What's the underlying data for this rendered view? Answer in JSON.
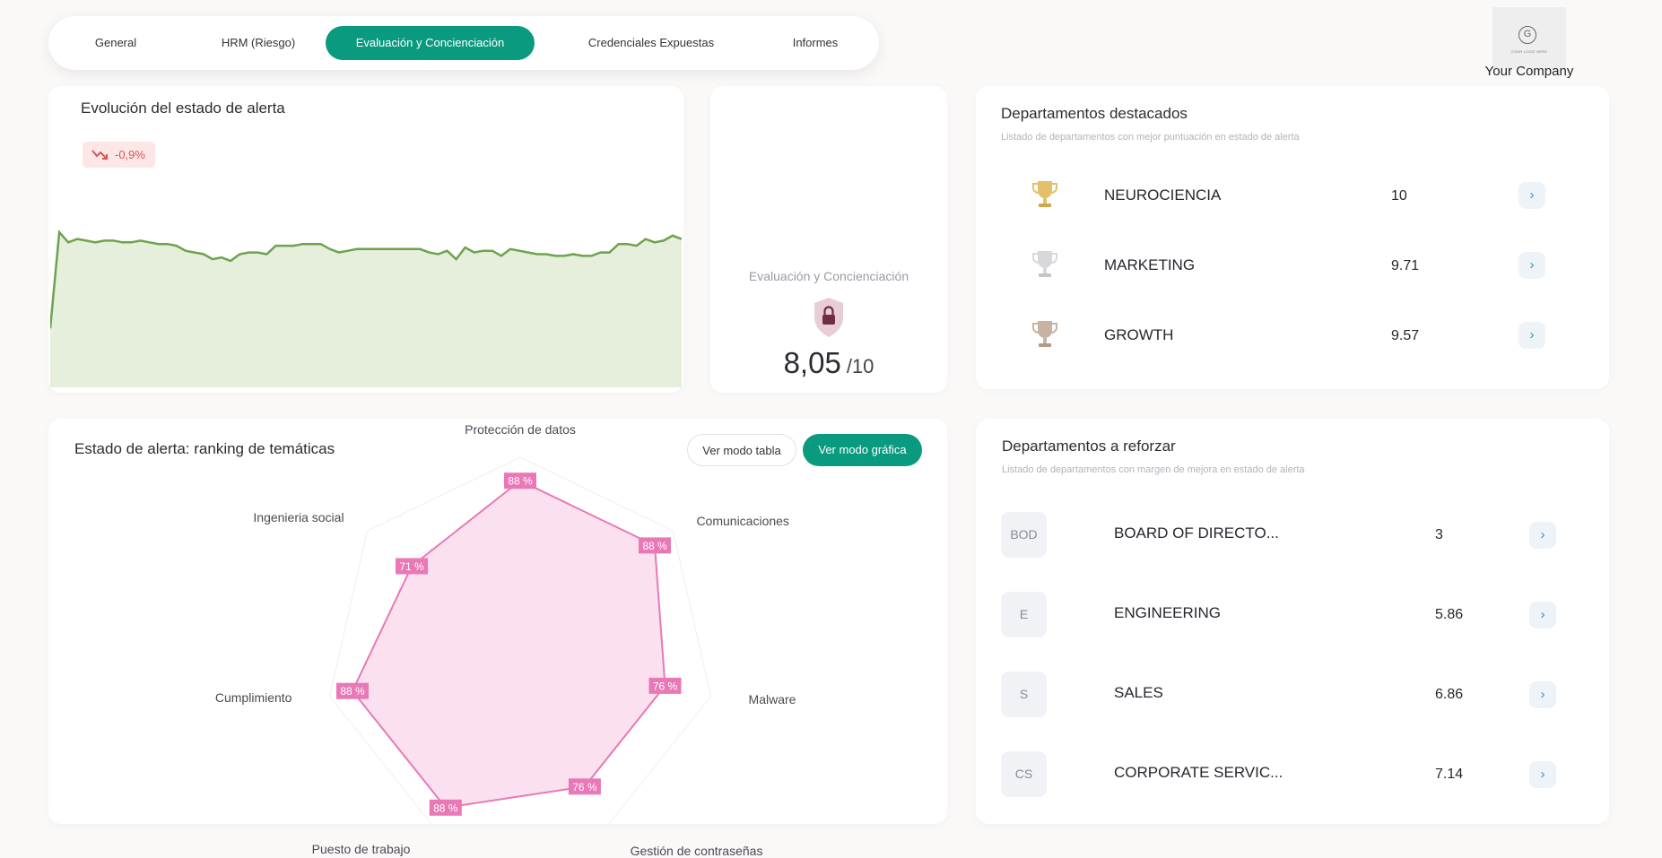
{
  "nav": {
    "tabs": [
      {
        "label": "General"
      },
      {
        "label": "HRM (Riesgo)"
      },
      {
        "label": "Evaluación y Concienciación"
      },
      {
        "label": "Credenciales Expuestas"
      },
      {
        "label": "Informes"
      }
    ],
    "active_index": 2,
    "accent_color": "#0a9a80"
  },
  "brand": {
    "logo_glyph": "G",
    "logo_placeholder": "YOUR LOGO HERE",
    "company_name": "Your Company"
  },
  "evolution": {
    "title": "Evolución del estado de alerta",
    "trend_badge": "-0,9%",
    "trend_icon": "trend-down-icon",
    "trend_color": "#d05a5a",
    "line_color": "#6da34d",
    "fill_color": "#e6eedc"
  },
  "score": {
    "label": "Evaluación y Concienciación",
    "value": "8,05",
    "denominator": "/10",
    "icon": "shield-lock-icon"
  },
  "top_departments": {
    "title": "Departamentos destacados",
    "subtitle": "Listado de departamentos con mejor puntuación en estado de alerta",
    "items": [
      {
        "name": "NEUROCIENCIA",
        "score": "10",
        "icon": "trophy-gold-icon"
      },
      {
        "name": "MARKETING",
        "score": "9.71",
        "icon": "trophy-silver-icon"
      },
      {
        "name": "GROWTH",
        "score": "9.57",
        "icon": "trophy-bronze-icon"
      }
    ]
  },
  "ranking": {
    "title": "Estado de alerta: ranking de temáticas",
    "btn_table": "Ver modo tabla",
    "btn_chart": "Ver modo gráfica"
  },
  "reinforce_departments": {
    "title": "Departamentos a reforzar",
    "subtitle": "Listado de departamentos con margen de mejora en estado de alerta",
    "items": [
      {
        "abbr": "BOD",
        "name": "BOARD OF DIRECTO...",
        "score": "3"
      },
      {
        "abbr": "E",
        "name": "ENGINEERING",
        "score": "5.86"
      },
      {
        "abbr": "S",
        "name": "SALES",
        "score": "6.86"
      },
      {
        "abbr": "CS",
        "name": "CORPORATE SERVIC...",
        "score": "7.14"
      }
    ]
  },
  "chart_data": [
    {
      "type": "area",
      "title": "Evolución del estado de alerta",
      "x": [],
      "y_normalized_note": "",
      "values": [
        0.35,
        0.92,
        0.86,
        0.88,
        0.87,
        0.86,
        0.87,
        0.87,
        0.86,
        0.86,
        0.87,
        0.86,
        0.85,
        0.85,
        0.84,
        0.81,
        0.8,
        0.79,
        0.76,
        0.77,
        0.75,
        0.79,
        0.8,
        0.8,
        0.79,
        0.84,
        0.84,
        0.84,
        0.85,
        0.85,
        0.85,
        0.82,
        0.8,
        0.81,
        0.82,
        0.82,
        0.82,
        0.82,
        0.82,
        0.82,
        0.82,
        0.82,
        0.8,
        0.79,
        0.81,
        0.76,
        0.83,
        0.8,
        0.81,
        0.81,
        0.78,
        0.82,
        0.81,
        0.8,
        0.79,
        0.79,
        0.78,
        0.78,
        0.79,
        0.78,
        0.78,
        0.8,
        0.8,
        0.85,
        0.85,
        0.84,
        0.88,
        0.86,
        0.87,
        0.9,
        0.88
      ],
      "ylim": [
        0,
        1
      ],
      "color": "#6da34d"
    },
    {
      "type": "radar",
      "categories": [
        "Protección de datos",
        "Comunicaciones",
        "Malware",
        "Gestión de contraseñas",
        "Puesto de trabajo",
        "Cumplimiento",
        "Ingenieria social"
      ],
      "values": [
        88,
        88,
        76,
        76,
        88,
        88,
        71
      ],
      "value_labels": [
        "88 %",
        "88 %",
        "76 %",
        "76 %",
        "88 %",
        "88 %",
        "71 %"
      ],
      "rmax": 100,
      "color": "#e879b6"
    }
  ]
}
